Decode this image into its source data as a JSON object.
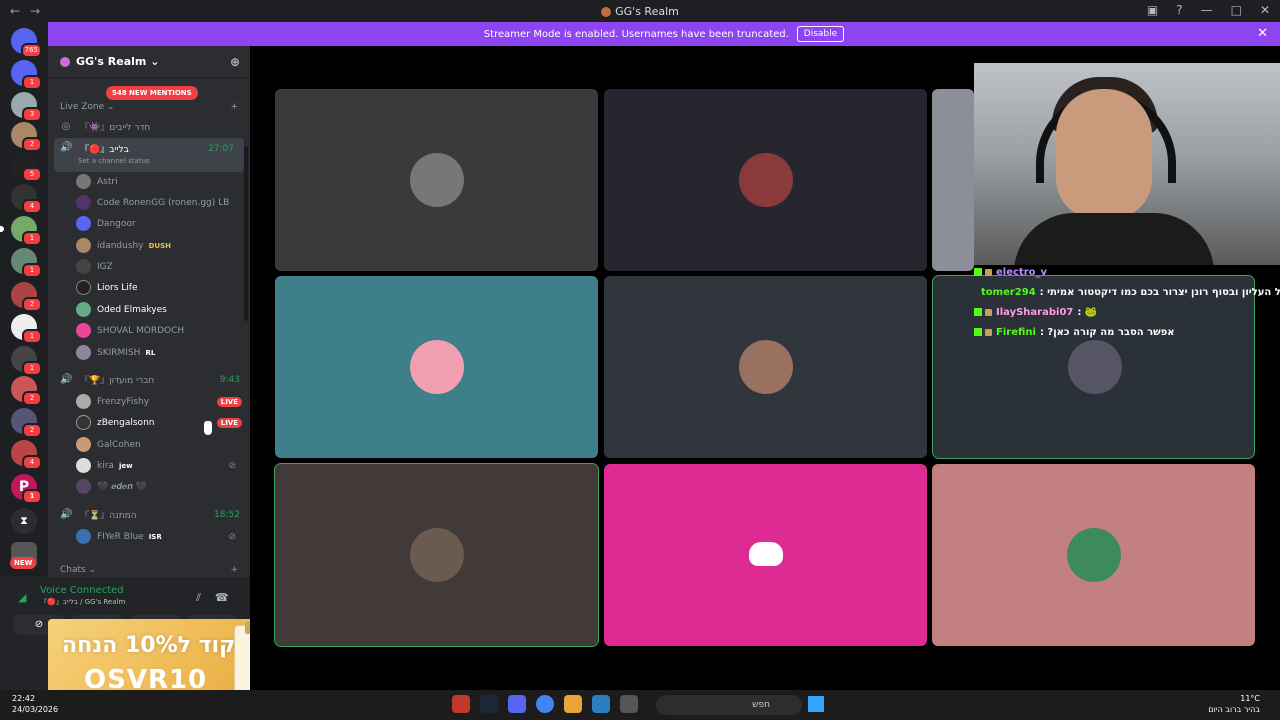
{
  "window": {
    "title": "GG's Realm"
  },
  "banner": {
    "text": "Streamer Mode is enabled. Usernames have been truncated.",
    "disable_label": "Disable"
  },
  "servers": {
    "home_badge": "765",
    "badges": [
      "1",
      "3",
      "2",
      "5",
      "4",
      "1",
      "1",
      "2",
      "1",
      "1",
      "2",
      "2",
      "4",
      "1"
    ],
    "new_label": "NEW"
  },
  "guild": {
    "name": "GG's Realm ⌄",
    "mentions": "548 NEW MENTIONS"
  },
  "channels": {
    "live_zone": "Live Zone ⌄",
    "lives_room": "『👾』חדר לייבים",
    "live_channel": {
      "name": "『🔴』בלייב",
      "time": "27:07",
      "status": "Set a channel status"
    },
    "club_channel": {
      "name": "『🏆』חברי מועדון",
      "time": "9:43"
    },
    "wait_channel": {
      "name": "『⏳』המתנה",
      "time": "18:52"
    },
    "chats": "Chats ⌄"
  },
  "live_users": [
    {
      "name": "Astri",
      "tag": ""
    },
    {
      "name": "Code RonenGG (ronen.gg) LB",
      "tag": ""
    },
    {
      "name": "Dangoor",
      "tag": ""
    },
    {
      "name": "idandushy",
      "tag": "DUSH"
    },
    {
      "name": "IGZ",
      "tag": ""
    },
    {
      "name": "Liors Life",
      "tag": ""
    },
    {
      "name": "Oded Elmakyes",
      "tag": ""
    },
    {
      "name": "SHOVAL MORDOCH",
      "tag": ""
    },
    {
      "name": "SKIRMISH",
      "tag": "RL"
    }
  ],
  "club_users": [
    {
      "name": "FrenzyFishy",
      "live": "LIVE"
    },
    {
      "name": "zBengalsonn",
      "live": "LIVE"
    },
    {
      "name": "GalCohen",
      "live": ""
    },
    {
      "name": "kira",
      "tag": "jew"
    },
    {
      "name": "🖤 𝒆𝒅𝒆𝒏 🖤"
    }
  ],
  "wait_users": [
    {
      "name": "FIYeR Blue",
      "tag": "ISR"
    }
  ],
  "voice": {
    "status": "Voice Connected",
    "sub": "『🔴』בלייב / GG's Realm"
  },
  "promo": {
    "line1": "קוד ל10% הנחה",
    "line2": "OSVR10"
  },
  "chat": [
    {
      "name": "electro_v",
      "text": "",
      "color": "#b98cff"
    },
    {
      "name": "tomer294",
      "text": ": של העליון ובסוף רונן יצרור בכם כמו דיקטטור אמיתי",
      "color": "#53fc18"
    },
    {
      "name": "IlaySharabi07",
      "text": ": 🐸",
      "color": "#ff9de2"
    },
    {
      "name": "Firefini",
      "text": ": ?אפשר הסבר מה קורה כאן",
      "color": "#53fc18"
    }
  ],
  "taskbar": {
    "time": "22:42",
    "date": "24/03/2026",
    "search": "חפש",
    "temp": "11°C",
    "weather": "בהיר ברוב היום"
  },
  "colors": {
    "accent": "#8e44f0",
    "online": "#23a55a",
    "live": "#ed4245",
    "kick": "#53fc18"
  }
}
